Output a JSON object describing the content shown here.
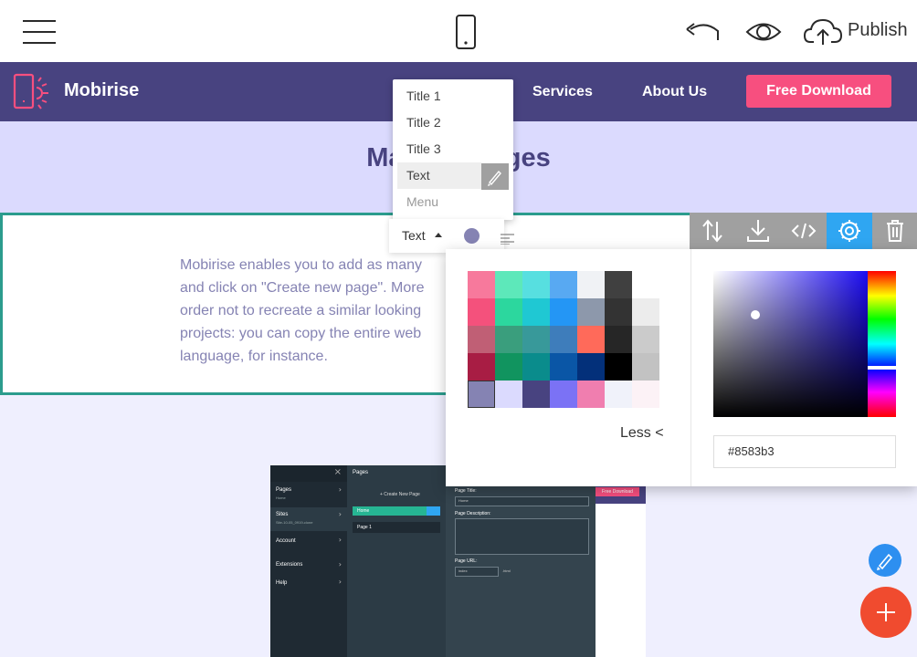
{
  "editor": {
    "publish_label": "Publish",
    "icons": [
      "menu-icon",
      "mobile-preview-icon",
      "undo-icon",
      "preview-eye-icon",
      "cloud-upload-icon"
    ]
  },
  "site_nav": {
    "brand": "Mobirise",
    "links": [
      "Services",
      "About Us"
    ],
    "cta": "Free Download"
  },
  "hero": {
    "title": "Manage Pages"
  },
  "text_block": {
    "lines": [
      "Mobirise enables you to add as many",
      "and click on \"Create new page\". More",
      "order not to recreate a similar looking",
      "projects: you can copy the entire web",
      "language, for instance."
    ]
  },
  "heading_dropdown": {
    "items": [
      "Title 1",
      "Title 2",
      "Title 3",
      "Text",
      "Menu"
    ],
    "selected": "Text"
  },
  "format_toolbar": {
    "style_label": "Text",
    "color": "#8583b3"
  },
  "block_toolbar": {
    "buttons": [
      "reorder-icon",
      "download-icon",
      "code-icon",
      "settings-icon",
      "delete-icon"
    ],
    "active": "settings-icon"
  },
  "color_picker": {
    "swatches": [
      [
        "#f7799c",
        "#5de8ba",
        "#57dfe0",
        "#58a9f2",
        "#f0f2f5",
        "#404040",
        "#ffffff"
      ],
      [
        "#f4517c",
        "#2cd79e",
        "#1fc8d3",
        "#2496f5",
        "#8d98ab",
        "#333333",
        "#ececec"
      ],
      [
        "#c05f75",
        "#3a9e7d",
        "#38999a",
        "#3e7dbb",
        "#ff6a5a",
        "#262626",
        "#cbcbcb"
      ],
      [
        "#a81d44",
        "#11945f",
        "#0a8c8c",
        "#0a56a6",
        "#03307a",
        "#000000",
        "#c2c2c2"
      ],
      [
        "#8583b3",
        "#dbdafe",
        "#484380",
        "#7b72f5",
        "#f07eaf",
        "#f0f2fa",
        "#fcf2f6"
      ]
    ],
    "selected": "#8583b3",
    "less_label": "Less <",
    "hex_value": "#8583b3"
  },
  "preview_shot": {
    "sidebar": [
      {
        "label": "Pages",
        "sub": "Home"
      },
      {
        "label": "Sites",
        "sub": "Site-10-05_0919-clone"
      },
      {
        "label": "Account",
        "sub": ""
      },
      {
        "label": "Extensions",
        "sub": ""
      },
      {
        "label": "Help",
        "sub": ""
      }
    ],
    "pages_title": "Pages",
    "create_label": "+ Create New Page",
    "home_label": "Home",
    "page1_label": "Page 1",
    "page_title_label": "Page Title:",
    "page_title_value": "Home",
    "page_desc_label": "Page Description:",
    "page_url_label": "Page URL:",
    "page_url_value": "index",
    "page_url_ext": ".html",
    "cta": "Free Download"
  },
  "fabs": [
    "brush-fab-icon",
    "add-block-icon"
  ]
}
